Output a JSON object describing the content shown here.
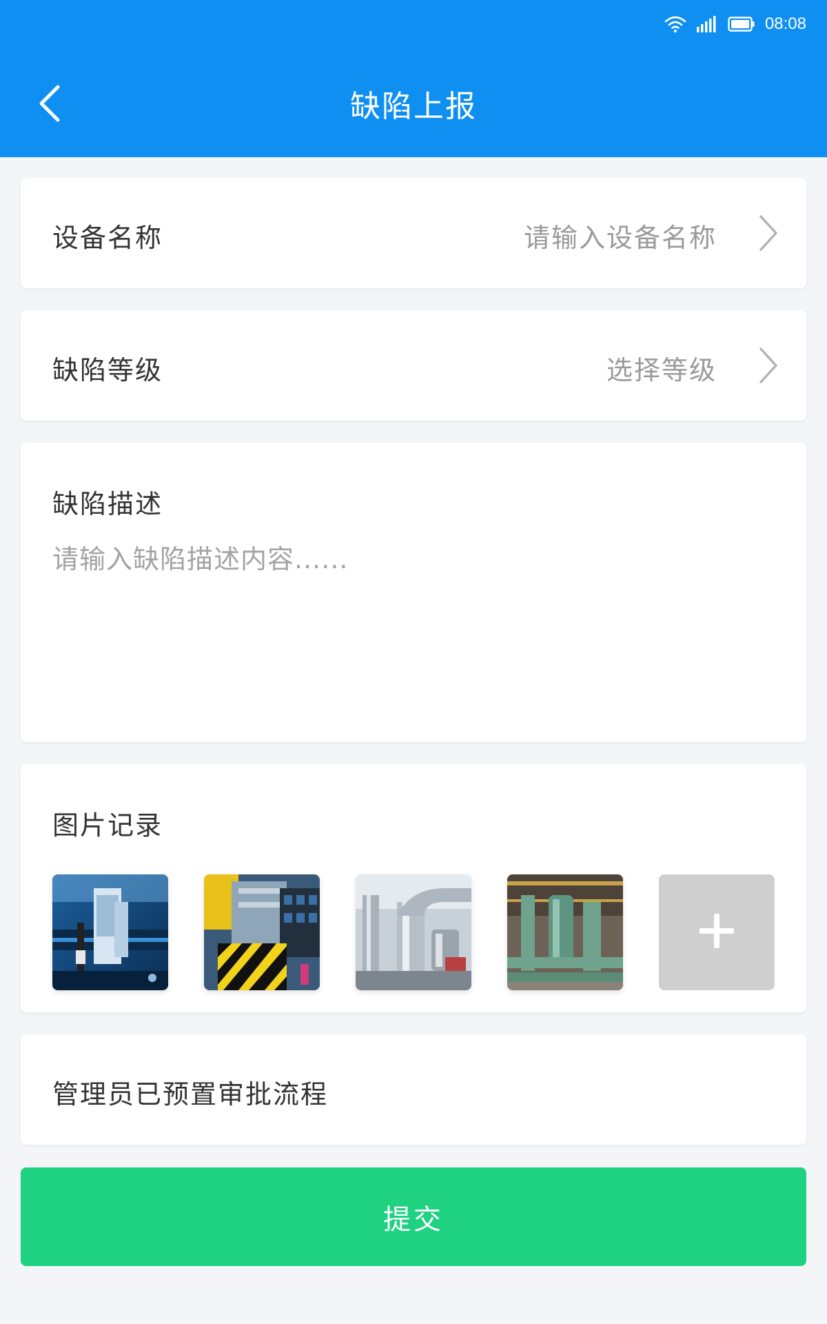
{
  "status_bar": {
    "time": "08:08",
    "icons": [
      "wifi-icon",
      "signal-icon",
      "battery-icon"
    ]
  },
  "header": {
    "title": "缺陷上报",
    "back_icon": "chevron-left-icon"
  },
  "device": {
    "label": "设备名称",
    "placeholder": "请输入设备名称"
  },
  "level": {
    "label": "缺陷等级",
    "placeholder": "选择等级"
  },
  "description": {
    "label": "缺陷描述",
    "placeholder": "请输入缺陷描述内容......"
  },
  "photos": {
    "label": "图片记录",
    "items": [
      "equipment-photo-1",
      "equipment-photo-2",
      "equipment-photo-3",
      "equipment-photo-4"
    ],
    "add_icon": "plus-icon"
  },
  "approval": {
    "text": "管理员已预置审批流程"
  },
  "submit": {
    "label": "提交"
  },
  "colors": {
    "primary": "#0f8ff2",
    "submit": "#1fd282",
    "background": "#f3f5f8",
    "placeholder": "#9a9a9a",
    "add_tile": "#cfcfcf"
  }
}
